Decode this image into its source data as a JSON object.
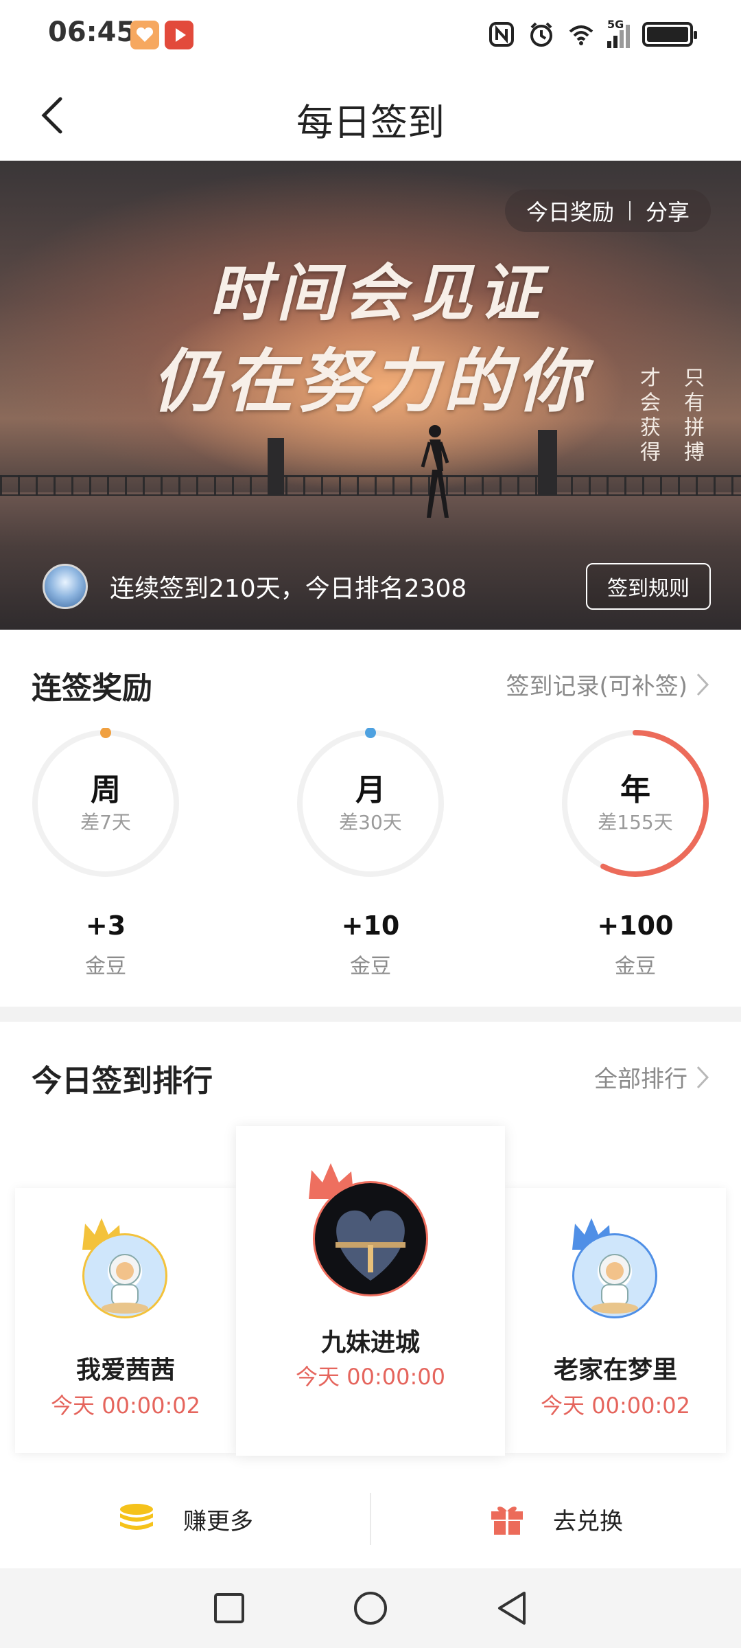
{
  "status_bar": {
    "time": "06:45",
    "icons": [
      "nfc-icon",
      "alarm-icon",
      "wifi-icon",
      "5g-signal-icon",
      "battery-icon"
    ],
    "network_label": "5G"
  },
  "header": {
    "title": "每日签到",
    "back_icon": "chevron-left-icon"
  },
  "banner": {
    "pill_reward": "今日奖励",
    "pill_share": "分享",
    "headline_line1": "时间会见证",
    "headline_line2": "仍在努力的你",
    "poem_col1": "只有拼搏",
    "poem_col2": "才会获得",
    "streak_text": "连续签到210天，今日排名2308",
    "rules_button": "签到规则"
  },
  "rewards": {
    "title": "连签奖励",
    "record_link": "签到记录(可补签)",
    "items": [
      {
        "period": "周",
        "remaining": "差7天",
        "amount": "+3",
        "unit": "金豆",
        "progress": 0.0,
        "dot_color": "#f0a040"
      },
      {
        "period": "月",
        "remaining": "差30天",
        "amount": "+10",
        "unit": "金豆",
        "progress": 0.0,
        "dot_color": "#4ea1e0"
      },
      {
        "period": "年",
        "remaining": "差155天",
        "amount": "+100",
        "unit": "金豆",
        "progress": 0.575,
        "dot_color": "#ec6b5a"
      }
    ]
  },
  "ranking": {
    "title": "今日签到排行",
    "all_link": "全部排行",
    "entries": [
      {
        "rank": 2,
        "name": "我爱茜茜",
        "time": "今天 00:00:02",
        "crown_color": "#f3c23b"
      },
      {
        "rank": 1,
        "name": "九妹进城",
        "time": "今天 00:00:00",
        "crown_color": "#ee6f5f"
      },
      {
        "rank": 3,
        "name": "老家在梦里",
        "time": "今天 00:00:02",
        "crown_color": "#4f8fe6"
      }
    ]
  },
  "actions": {
    "earn": "赚更多",
    "redeem": "去兑换"
  },
  "colors": {
    "accent_red": "#e5655d",
    "coin_yellow": "#f5c21b",
    "gift_red": "#ec6b5a"
  }
}
